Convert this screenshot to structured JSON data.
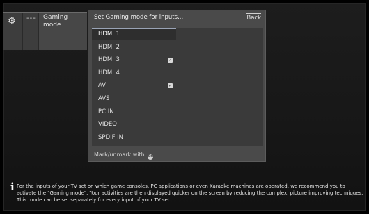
{
  "side_menu": {
    "gear_glyph": "⚙",
    "dots_glyph": "---",
    "gaming_label": "Gaming mode"
  },
  "dialog": {
    "title": "Set Gaming mode for inputs...",
    "back_label": "Back",
    "footer_text": "Mark/unmark with",
    "ok_icon_text": "OK",
    "inputs": [
      {
        "label": "HDMI 1",
        "checked": false,
        "selected": true
      },
      {
        "label": "HDMI 2",
        "checked": false,
        "selected": false
      },
      {
        "label": "HDMI 3",
        "checked": true,
        "selected": false
      },
      {
        "label": "HDMI 4",
        "checked": false,
        "selected": false
      },
      {
        "label": "AV",
        "checked": true,
        "selected": false
      },
      {
        "label": "AVS",
        "checked": false,
        "selected": false
      },
      {
        "label": "PC IN",
        "checked": false,
        "selected": false
      },
      {
        "label": "VIDEO",
        "checked": false,
        "selected": false
      },
      {
        "label": "SPDIF IN",
        "checked": false,
        "selected": false
      }
    ]
  },
  "info": {
    "text": "For the inputs of your TV set on which game consoles, PC applications or even Karaoke machines are operated, we recommend you to activate the \"Gaming mode\". Your activities are then displayed quicker on the screen by reducing the complex, picture improving techniques. This mode can be set separately for every input of your TV set."
  },
  "colors": {
    "panel": "#4a4a4a",
    "list_bg": "#3a3a3a",
    "selection_line": "#9aa4b6"
  }
}
